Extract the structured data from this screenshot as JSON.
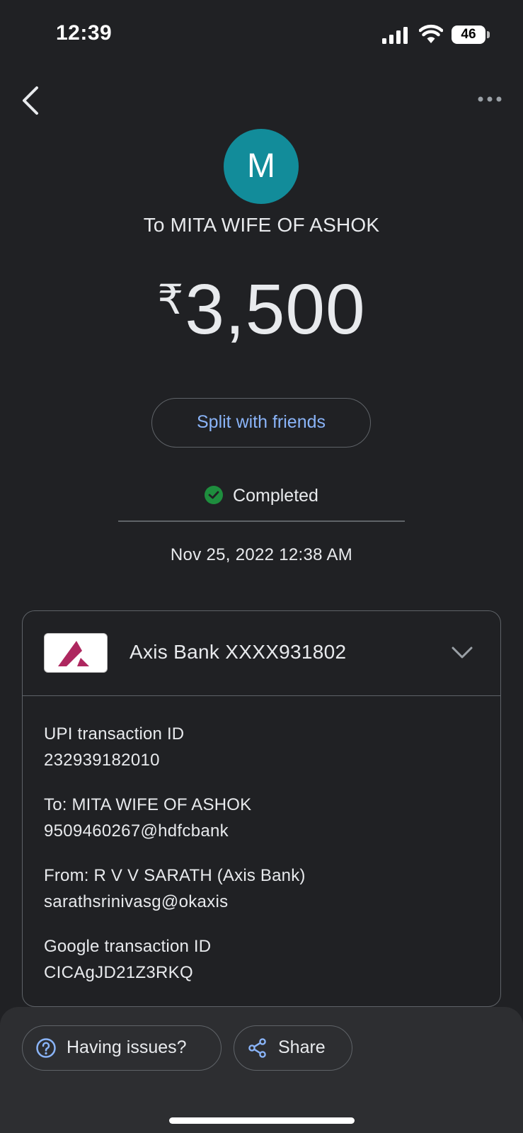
{
  "status_bar": {
    "time": "12:39",
    "battery": "46",
    "icons": [
      "cellular-signal-icon",
      "wifi-icon",
      "battery-icon"
    ]
  },
  "header": {
    "back_icon": "chevron-left-icon",
    "more_icon": "more-horizontal-icon"
  },
  "payee": {
    "avatar_initial": "M",
    "avatar_color": "#128c9a",
    "recipient": "To MITA WIFE OF ASHOK"
  },
  "amount": {
    "currency": "₹",
    "value": "3,500"
  },
  "split_button_label": "Split with friends",
  "status": {
    "label": "Completed",
    "color": "#1e8e3e",
    "icon": "check-circle-icon"
  },
  "datetime": "Nov 25, 2022 12:38 AM",
  "card": {
    "bank_label": "Axis Bank XXXX931802",
    "bank_logo_color": "#ae275f",
    "expand_icon": "chevron-down-icon",
    "details": [
      {
        "label": "UPI transaction ID",
        "value": "232939182010"
      },
      {
        "label": "To: MITA WIFE OF ASHOK",
        "value": "9509460267@hdfcbank"
      },
      {
        "label": "From: R V V SARATH (Axis Bank)",
        "value": "sarathsrinivasg@okaxis"
      },
      {
        "label": "Google transaction ID",
        "value": "CICAgJD21Z3RKQ"
      }
    ]
  },
  "actions": {
    "issues_label": "Having issues?",
    "share_label": "Share",
    "accent": "#8ab4f8"
  }
}
